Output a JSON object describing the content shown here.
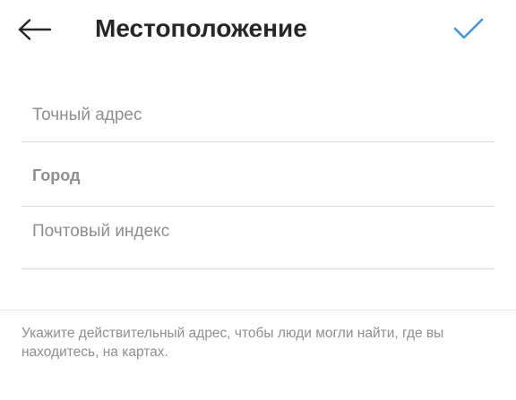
{
  "header": {
    "title": "Местоположение",
    "back_icon": "arrow-left-icon",
    "confirm_icon": "checkmark-icon"
  },
  "form": {
    "address": {
      "placeholder": "Точный адрес",
      "value": ""
    },
    "city": {
      "value": "Город"
    },
    "postal": {
      "placeholder": "Почтовый индекс",
      "value": ""
    }
  },
  "hint": "Укажите действительный адрес, чтобы люди могли найти, где вы находитесь, на картах.",
  "colors": {
    "accent": "#3897f0",
    "text": "#262626",
    "secondary": "#8e8e8e",
    "divider": "#dbdbdb"
  }
}
